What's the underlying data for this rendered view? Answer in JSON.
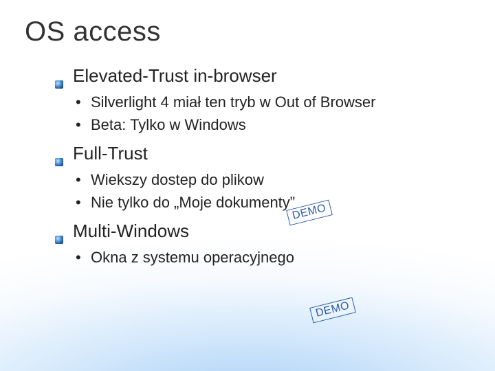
{
  "title": "OS access",
  "topics": [
    {
      "heading": "Elevated-Trust in-browser",
      "subs": [
        "Silverlight 4 miał ten tryb w Out of Browser",
        "Beta: Tylko w Windows"
      ]
    },
    {
      "heading": "Full-Trust",
      "subs": [
        "Wiekszy dostep do plikow",
        "Nie tylko do „Moje dokumenty”"
      ]
    },
    {
      "heading": "Multi-Windows",
      "subs": [
        "Okna z systemu operacyjnego"
      ]
    }
  ],
  "demo_label": "DEMO"
}
